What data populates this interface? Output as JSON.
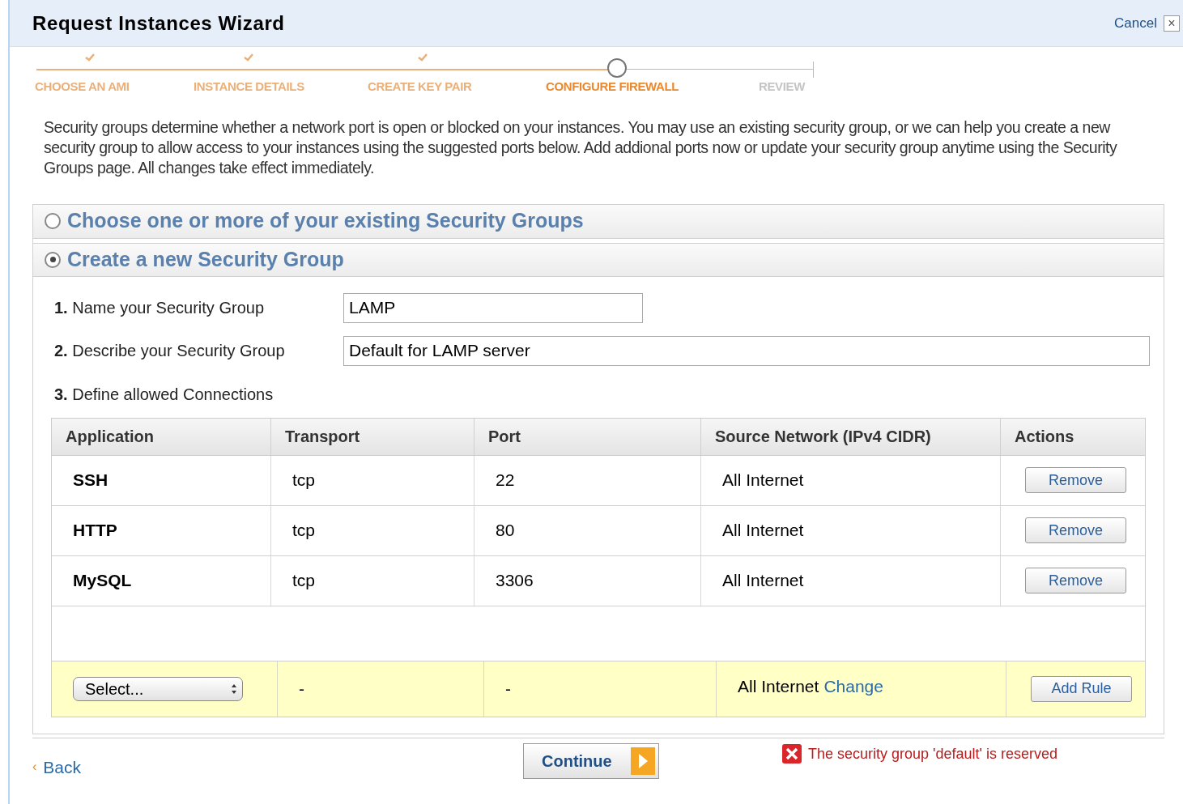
{
  "window": {
    "title": "Request Instances Wizard",
    "cancel": "Cancel",
    "close": "×"
  },
  "steps": [
    {
      "label": "CHOOSE AN AMI",
      "completed": true,
      "current": false
    },
    {
      "label": "INSTANCE DETAILS",
      "completed": true,
      "current": false
    },
    {
      "label": "CREATE KEY PAIR",
      "completed": true,
      "current": false
    },
    {
      "label": "CONFIGURE FIREWALL",
      "completed": false,
      "current": true
    },
    {
      "label": "REVIEW",
      "completed": false,
      "current": false
    }
  ],
  "intro": "Security groups determine whether a network port is open or blocked on your instances. You may use an existing security group, or we can help you create a new security group to allow access to your instances using the suggested ports below. Add addional ports now or update your security group anytime using the Security Groups page. All changes take effect immediately.",
  "options": [
    {
      "label": "Choose one or more of your existing Security Groups",
      "selected": false
    },
    {
      "label": "Create a new Security Group",
      "selected": true
    }
  ],
  "form": {
    "name_label": {
      "number": "1.",
      "text": "Name your Security Group"
    },
    "name_value": "LAMP",
    "describe_label": {
      "number": "2.",
      "text": "Describe your Security Group"
    },
    "describe_value": "Default for LAMP server",
    "connections_label": {
      "number": "3.",
      "text": "Define allowed Connections"
    }
  },
  "table": {
    "columns": [
      "Application",
      "Transport",
      "Port",
      "Source Network (IPv4 CIDR)",
      "Actions"
    ],
    "rows": [
      {
        "application": "SSH",
        "transport": "tcp",
        "port": "22",
        "source": "All Internet",
        "action": "Remove"
      },
      {
        "application": "HTTP",
        "transport": "tcp",
        "port": "80",
        "source": "All Internet",
        "action": "Remove"
      },
      {
        "application": "MySQL",
        "transport": "tcp",
        "port": "3306",
        "source": "All Internet",
        "action": "Remove"
      }
    ],
    "new_rule": {
      "select": "Select...",
      "transport": "-",
      "port": "-",
      "source": "All Internet",
      "change": "Change",
      "add": "Add Rule"
    }
  },
  "footer": {
    "back_arrow": "‹",
    "back": "Back",
    "continue": "Continue",
    "error": "The security group 'default' is reserved"
  }
}
